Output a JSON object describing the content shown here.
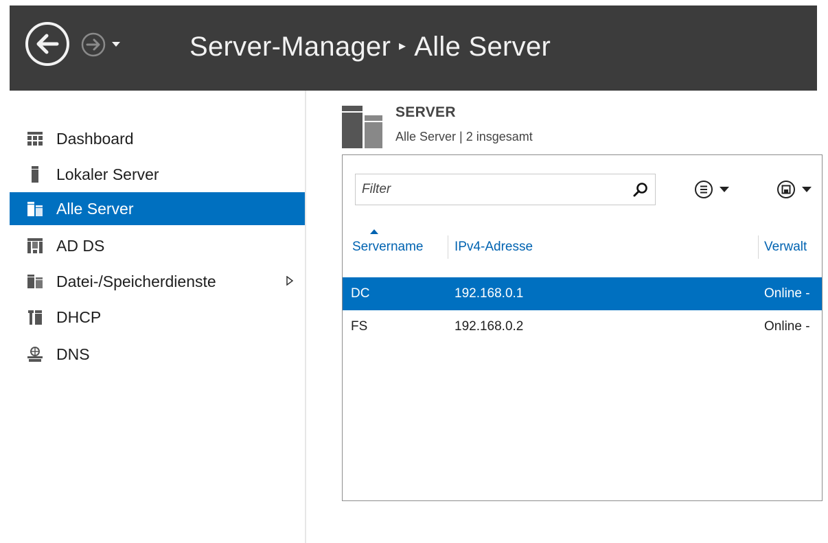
{
  "header": {
    "app_title": "Server-Manager",
    "separator": "▸",
    "page_title": "Alle Server"
  },
  "sidebar": {
    "items": [
      {
        "label": "Dashboard",
        "icon": "dashboard-icon"
      },
      {
        "label": "Lokaler Server",
        "icon": "server-icon"
      },
      {
        "label": "Alle Server",
        "icon": "all-servers-icon",
        "active": true
      },
      {
        "label": "AD DS",
        "icon": "ad-ds-icon"
      },
      {
        "label": "Datei-/Speicherdienste",
        "icon": "file-storage-icon",
        "has_submenu": true
      },
      {
        "label": "DHCP",
        "icon": "dhcp-icon"
      },
      {
        "label": "DNS",
        "icon": "dns-icon"
      }
    ]
  },
  "main": {
    "section_title": "SERVER",
    "section_subtitle": "Alle Server | 2 insgesamt",
    "filter_placeholder": "Filter",
    "columns": [
      "Servername",
      "IPv4-Adresse",
      "Verwalt"
    ],
    "rows": [
      {
        "name": "DC",
        "ip": "192.168.0.1",
        "status": "Online -",
        "selected": true
      },
      {
        "name": "FS",
        "ip": "192.168.0.2",
        "status": "Online -",
        "selected": false
      }
    ]
  },
  "colors": {
    "titlebar_bg": "#3c3c3c",
    "accent": "#0070c0",
    "column_header": "#0063b1"
  }
}
